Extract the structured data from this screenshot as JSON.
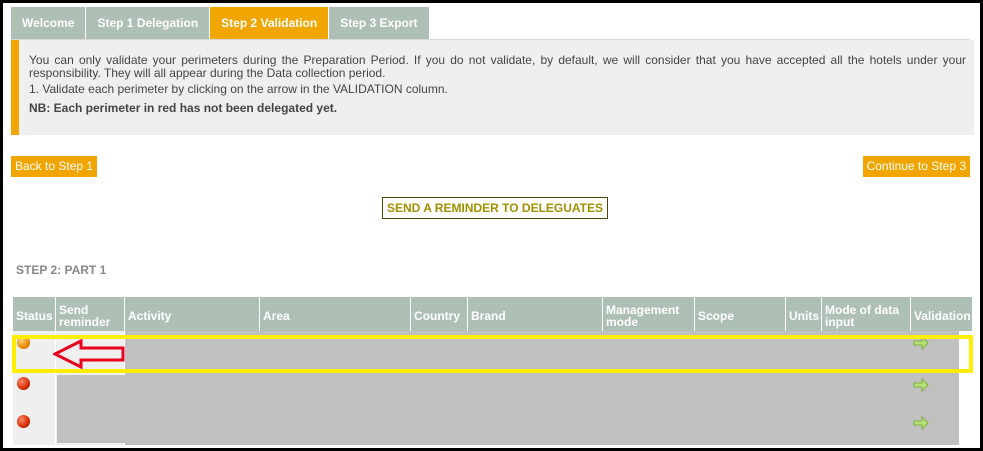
{
  "tabs": [
    {
      "label": "Welcome",
      "active": false
    },
    {
      "label": "Step 1 Delegation",
      "active": false
    },
    {
      "label": "Step 2 Validation",
      "active": true
    },
    {
      "label": "Step 3 Export",
      "active": false
    }
  ],
  "info": {
    "line1": "You can only validate your perimeters during the Preparation Period. If you do not validate, by default, we will consider that you have accepted all the hotels under your responsibility. They will all appear during the Data collection period.",
    "line2": "1. Validate each perimeter by clicking on the arrow in the VALIDATION column.",
    "nb": "NB: Each perimeter in red has not been delegated yet."
  },
  "buttons": {
    "back": "Back to Step 1",
    "continue": "Continue to Step 3",
    "reminder": "SEND A REMINDER TO DELEGUATES"
  },
  "section_title": "STEP 2: PART 1",
  "table": {
    "columns": [
      "Status",
      "Send reminder",
      "Activity",
      "Area",
      "Country",
      "Brand",
      "Management mode",
      "Scope",
      "Units",
      "Mode of data input",
      "Validation"
    ],
    "rows": [
      {
        "status": "orange"
      },
      {
        "status": "red"
      },
      {
        "status": "red"
      }
    ]
  },
  "colors": {
    "accent": "#f0a500",
    "header": "#aebfb6",
    "highlight": "#ffee00",
    "annotation_arrow": "#e8001c"
  },
  "icons": {
    "validate": "green-arrow-right-icon",
    "status_pending": "orange-dot-icon",
    "status_not_delegated": "red-dot-icon"
  }
}
